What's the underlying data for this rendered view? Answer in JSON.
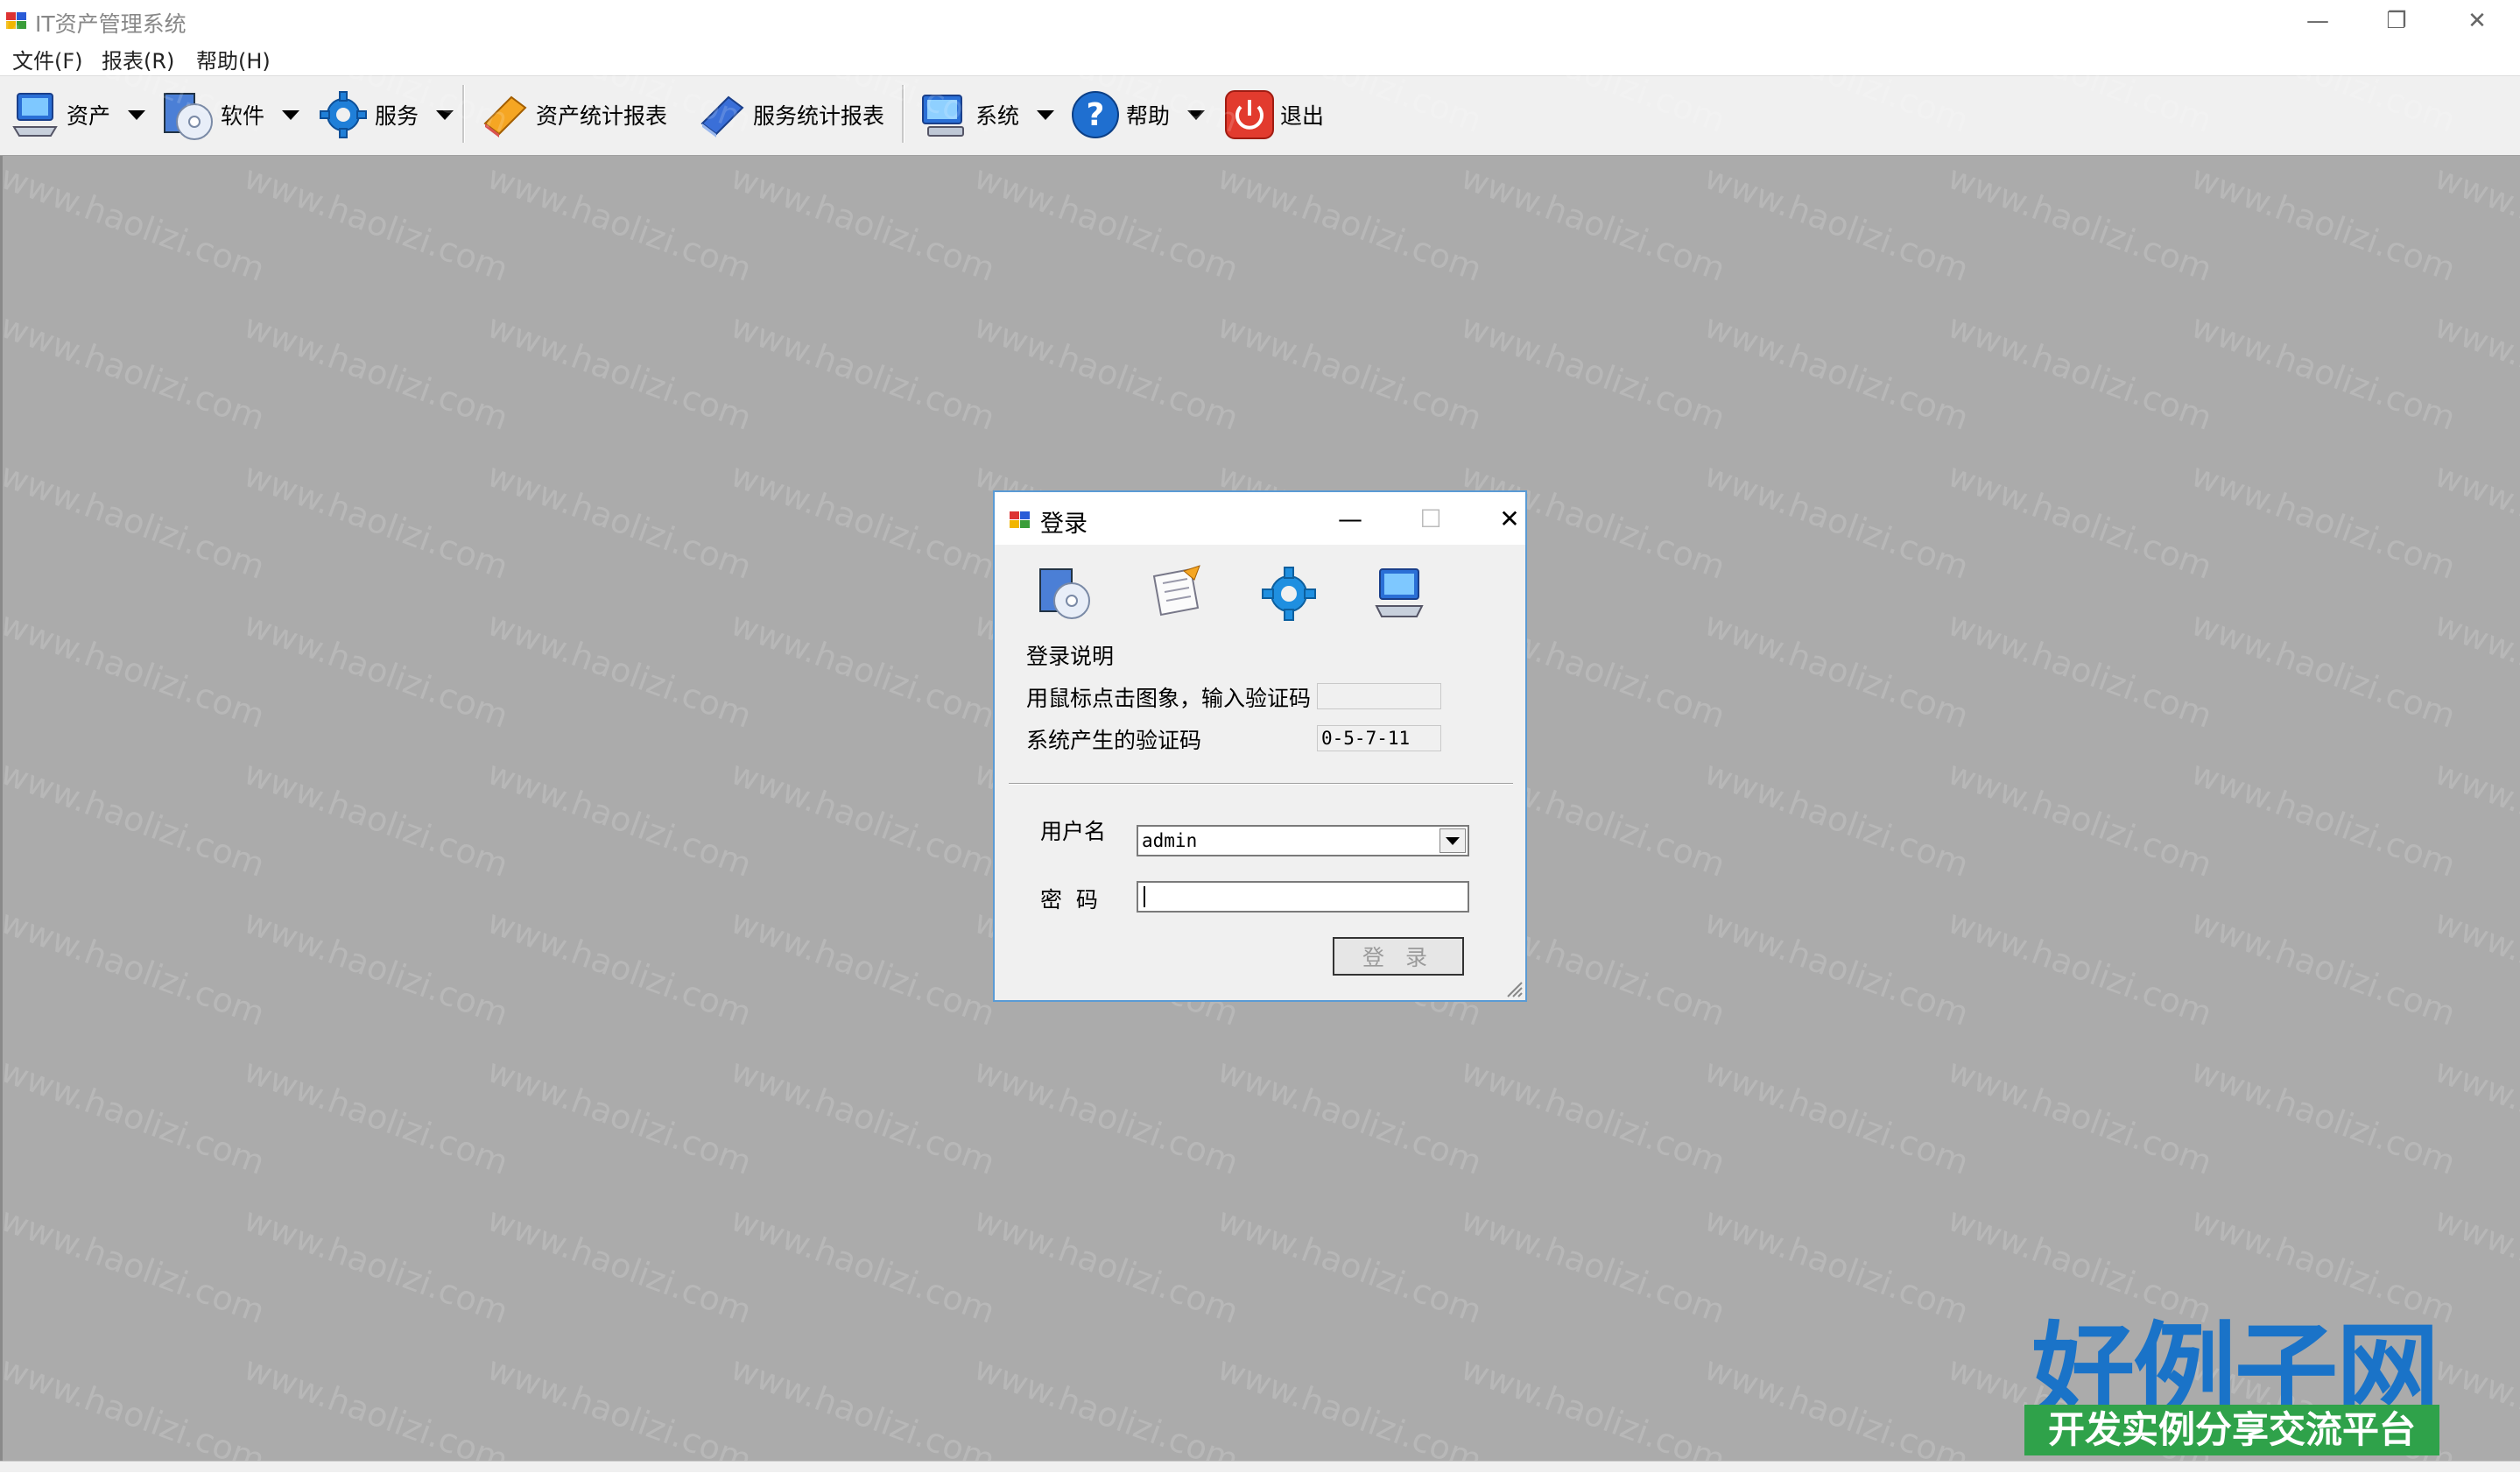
{
  "window": {
    "title": "IT资产管理系统",
    "minimize_glyph": "—",
    "restore_glyph": "❐",
    "close_glyph": "✕"
  },
  "menu": {
    "items": [
      "文件(F)",
      "报表(R)",
      "帮助(H)"
    ]
  },
  "toolbar": {
    "assets": "资产",
    "software": "软件",
    "service": "服务",
    "asset_report": "资产统计报表",
    "service_report": "服务统计报表",
    "system": "系统",
    "help": "帮助",
    "exit": "退出"
  },
  "watermark_text": "www.haolizi.com",
  "login": {
    "title": "登录",
    "minimize_glyph": "—",
    "maximize_glyph": "☐",
    "close_glyph": "✕",
    "instruction_title": "登录说明",
    "click_prompt": "用鼠标点击图象，输入验证码",
    "generated_code_label": "系统产生的验证码",
    "captcha_input": "",
    "generated_code": "0-5-7-11",
    "username_label": "用户名",
    "username_value": "admin",
    "password_label": "密  码",
    "password_value": "",
    "login_button": "登 录"
  },
  "brand": {
    "name": "好例子网",
    "slogan": "开发实例分享交流平台"
  },
  "colors": {
    "mdi_background": "#ababab",
    "dialog_border": "#5a9bd5",
    "brand_blue": "#1a73c8",
    "brand_green": "#2fa24a"
  }
}
